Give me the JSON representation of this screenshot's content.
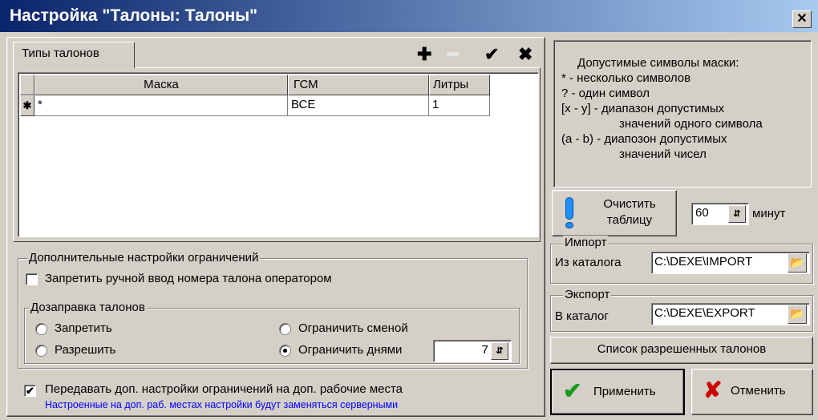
{
  "window": {
    "title": "Настройка \"Талоны: Талоны\"",
    "close_label": "✕"
  },
  "tabs": [
    {
      "label": "Типы талонов"
    }
  ],
  "toolbar": {
    "add": "✚",
    "remove": "━",
    "confirm": "✔",
    "cancel": "✖"
  },
  "grid": {
    "columns": [
      "Маска",
      "ГСМ",
      "Литры"
    ],
    "rows": [
      {
        "marker": "✱",
        "mask": "*",
        "fuel": "ВСЕ",
        "liters": "1"
      }
    ]
  },
  "restrictions": {
    "title": "Дополнительные настройки ограничений",
    "forbid_manual_label": "Запретить ручной ввод номера талона оператором",
    "forbid_manual_checked": false,
    "refill": {
      "title": "Дозаправка талонов",
      "options": [
        "Запретить",
        "Разрешить",
        "Ограничить сменой",
        "Ограничить днями"
      ],
      "selected": "Ограничить днями",
      "days_value": "7"
    }
  },
  "transfer": {
    "label": "Передавать доп. настройки ограничений на доп. рабочие места",
    "checked": true,
    "note": "Настроенные на доп. раб. местах настройки будут заменяться серверными"
  },
  "mask_help": {
    "title": "Допустимые символы маски:",
    "lines": [
      "* - несколько символов",
      "? - один символ",
      "[x - y] - диапазон допустимых",
      "значений одного символа",
      "(a - b) - диапозон допустимых",
      "значений чисел"
    ]
  },
  "clear": {
    "label_line1": "Очистить",
    "label_line2": "таблицу",
    "minutes_value": "60",
    "minutes_unit": "минут"
  },
  "import": {
    "title": "Импорт",
    "label": "Из каталога",
    "path": "C:\\DEXE\\IMPORT"
  },
  "export": {
    "title": "Экспорт",
    "label": "В каталог",
    "path": "C:\\DEXE\\EXPORT"
  },
  "allowed_list_button": "Список разрешенных талонов",
  "apply_button": "Применить",
  "cancel_button": "Отменить",
  "colors": {
    "title_bar_start": "#0a246a",
    "title_bar_end": "#a6caf0",
    "note_text": "#0000ff",
    "apply_icon": "#1a9a1a",
    "cancel_icon": "#cc0000",
    "info_icon": "#1e90ff"
  }
}
